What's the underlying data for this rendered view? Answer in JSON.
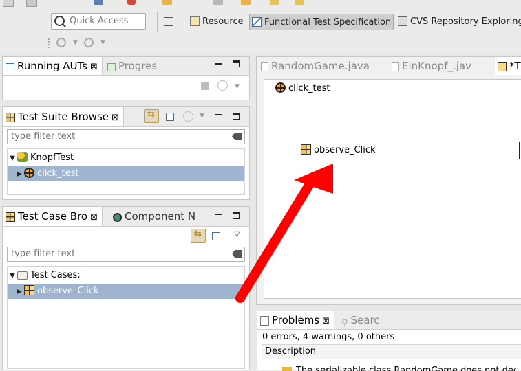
{
  "toolbar": {
    "quick_access_placeholder": "Quick Access",
    "perspectives": [
      {
        "label": "Resource",
        "active": false
      },
      {
        "label": "Functional Test Specification",
        "active": true
      },
      {
        "label": "CVS Repository Exploring",
        "active": false
      }
    ]
  },
  "running_auts_view": {
    "tabs": [
      {
        "label": "Running AUTs",
        "active": true
      },
      {
        "label": "Progres",
        "active": false
      }
    ]
  },
  "test_suite_browser": {
    "tab_label": "Test Suite Browse",
    "filter_placeholder": "type filter text",
    "tree": [
      {
        "label": "KnopfTest",
        "level": 0,
        "expanded": true,
        "icon": "project-icon"
      },
      {
        "label": "click_test",
        "level": 1,
        "expanded": false,
        "selected": true,
        "icon": "test-suite-icon"
      }
    ]
  },
  "test_case_browser": {
    "tabs": [
      {
        "label": "Test Case Bro",
        "active": true
      },
      {
        "label": "Component N",
        "active": false
      }
    ],
    "filter_placeholder": "type filter text",
    "tree": [
      {
        "label": "Test Cases:",
        "level": 0,
        "expanded": true,
        "icon": "folder-icon"
      },
      {
        "label": "observe_Click",
        "level": 1,
        "expanded": false,
        "selected": true,
        "icon": "test-case-icon"
      }
    ]
  },
  "editor": {
    "tabs": [
      {
        "label": "RandomGame.java",
        "active": false
      },
      {
        "label": "EinKnopf_.jav",
        "active": false
      },
      {
        "label": "*T",
        "active": true
      }
    ],
    "root_node": "click_test",
    "child_node": "observe_Click"
  },
  "problems_view": {
    "tabs": [
      {
        "label": "Problems",
        "active": true
      },
      {
        "label": "Searc",
        "active": false
      }
    ],
    "summary": "0 errors, 4 warnings, 0 others",
    "column_header": "Description",
    "first_row": "The serializable class RandomGame does not decl"
  },
  "colors": {
    "selection": "#9eb4cf",
    "annotation_arrow": "#ff0000"
  }
}
